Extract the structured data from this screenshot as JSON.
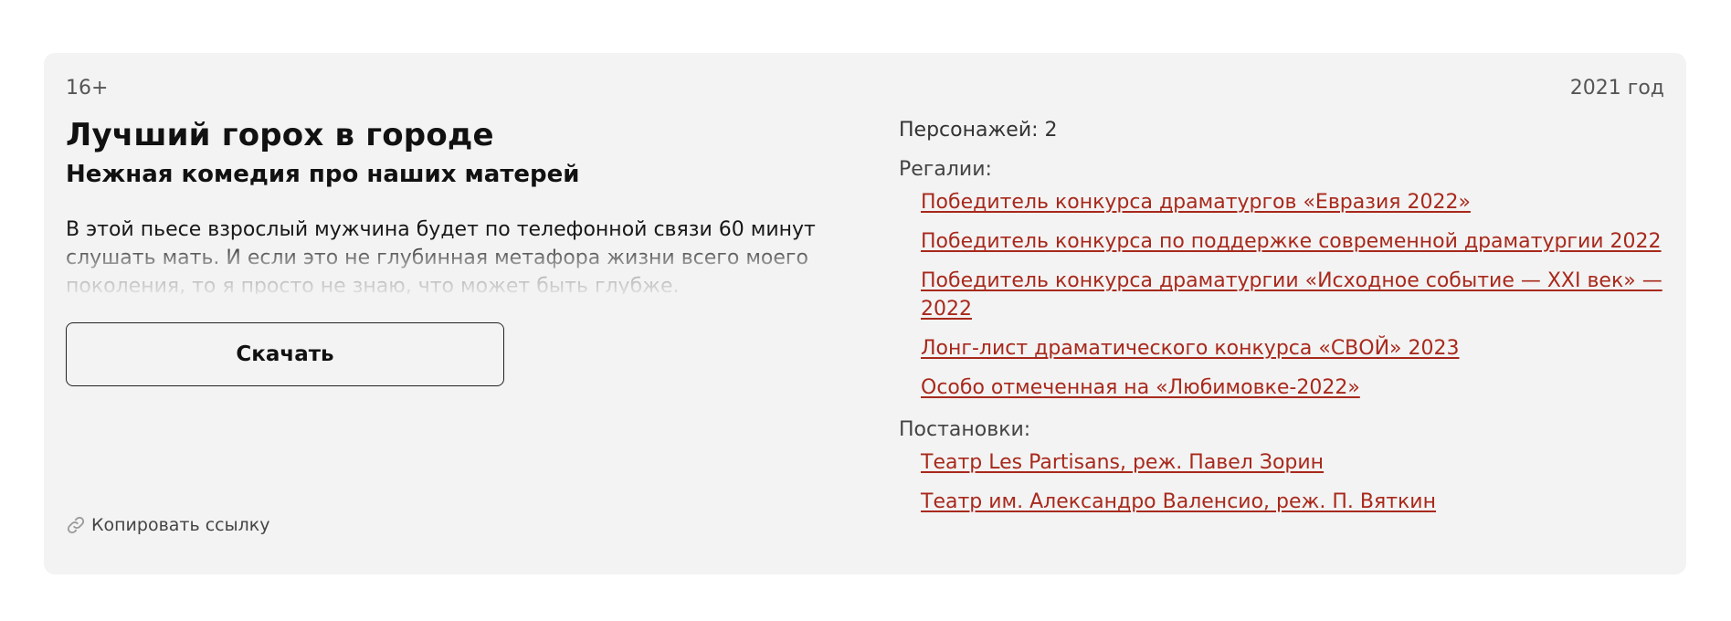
{
  "play": {
    "age_rating": "16+",
    "year": "2021 год",
    "title": "Лучший горох в городе",
    "subtitle": "Нежная комедия про наших матерей",
    "description": "В этой пьесе взрослый мужчина будет по телефонной связи 60 минут слушать мать. И если это не глубинная метафора жизни всего моего поколения, то я просто не знаю, что может быть глубже.",
    "download_label": "Скачать",
    "copy_link_label": "Копировать ссылку"
  },
  "details": {
    "characters": "Персонажей: 2",
    "awards_label": "Регалии:",
    "awards": [
      "Победитель конкурса драматургов «Евразия 2022»",
      "Победитель конкурса по поддержке современной драматургии 2022",
      "Победитель конкурса драматургии «Исходное событие — XXI век» — 2022",
      "Лонг-лист драматического конкурса «СВОЙ» 2023",
      "Особо отмеченная на «Любимовке-2022»"
    ],
    "productions_label": "Постановки:",
    "productions": [
      "Театр Les Partisans, реж. Павел Зорин",
      "Театр им. Александро Валенсио, реж. П. Вяткин"
    ]
  },
  "colors": {
    "card_background": "#f3f3f3",
    "link": "#a8291c",
    "text": "#111111"
  },
  "icons": {
    "copy_link": "link-icon"
  }
}
